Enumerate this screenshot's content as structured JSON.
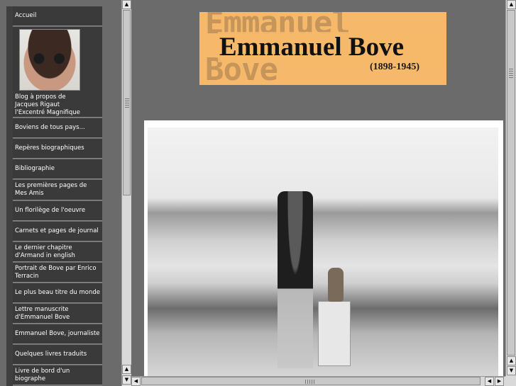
{
  "nav": {
    "items": [
      {
        "label": "Accueil"
      },
      {
        "label": "Blog à propos de\nJacques Rigaut\nl'Excentré Magnifique"
      },
      {
        "label": "Boviens de tous pays..."
      },
      {
        "label": "Repères biographiques"
      },
      {
        "label": "Bibliographie"
      },
      {
        "label": "Les premières pages de Mes Amis"
      },
      {
        "label": "Un florilège de l'oeuvre"
      },
      {
        "label": "Carnets et pages de journal"
      },
      {
        "label": "Le dernier chapitre d'Armand in english"
      },
      {
        "label": "Portrait de Bove par Enrico Terracin"
      },
      {
        "label": "Le plus beau titre du monde"
      },
      {
        "label": "Lettre manuscrite d'Emmanuel Bove"
      },
      {
        "label": "Emmanuel Bove, journaliste"
      },
      {
        "label": "Quelques livres traduits"
      },
      {
        "label": "Livre de bord d'un biographe"
      }
    ]
  },
  "banner": {
    "background_text_1": "Emmanuel",
    "background_text_2": "Bove",
    "title": "Emmanuel Bove",
    "dates": "(1898-1945)",
    "color": "#f6b86a"
  },
  "icons": {
    "up": "arrow-up-icon",
    "down": "arrow-down-icon",
    "left": "arrow-left-icon",
    "right": "arrow-right-icon"
  },
  "glyphs": {
    "up": "▲",
    "down": "▼",
    "left": "◀",
    "right": "▶"
  }
}
